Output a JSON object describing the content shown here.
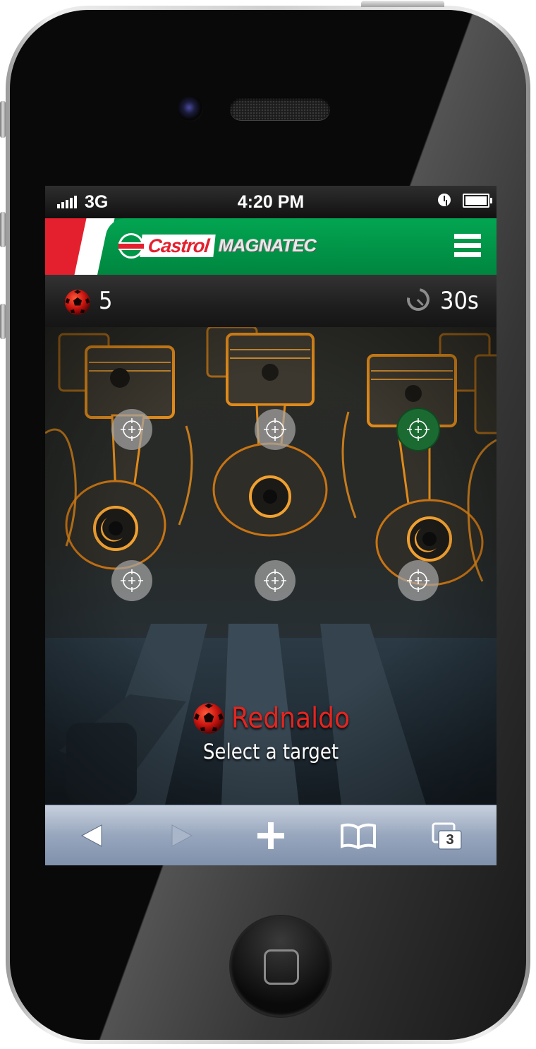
{
  "statusbar": {
    "carrier": "3G",
    "time": "4:20 PM"
  },
  "brand": {
    "name": "Castrol",
    "product": "MAGNATEC"
  },
  "hud": {
    "balls_remaining": "5",
    "time_left": "30s"
  },
  "targets": [
    {
      "row": 1,
      "col": 1,
      "selected": false
    },
    {
      "row": 1,
      "col": 2,
      "selected": false
    },
    {
      "row": 1,
      "col": 3,
      "selected": true
    },
    {
      "row": 2,
      "col": 1,
      "selected": false
    },
    {
      "row": 2,
      "col": 2,
      "selected": false
    },
    {
      "row": 2,
      "col": 3,
      "selected": false
    }
  ],
  "player": {
    "name": "Rednaldo",
    "prompt": "Select a target"
  },
  "toolbar": {
    "tab_count": "3"
  },
  "colors": {
    "brand_green": "#00964a",
    "brand_red": "#e4202e",
    "player_name_red": "#e52520",
    "selected_target_green": "#1b6a32",
    "engine_glow_orange": "#e08a1a"
  },
  "icons": [
    "signal-icon",
    "alarm-icon",
    "battery-icon",
    "menu-icon",
    "football-icon",
    "timer-icon",
    "crosshair-icon",
    "back-arrow-icon",
    "forward-arrow-icon",
    "add-icon",
    "bookmarks-icon",
    "tabs-icon"
  ]
}
